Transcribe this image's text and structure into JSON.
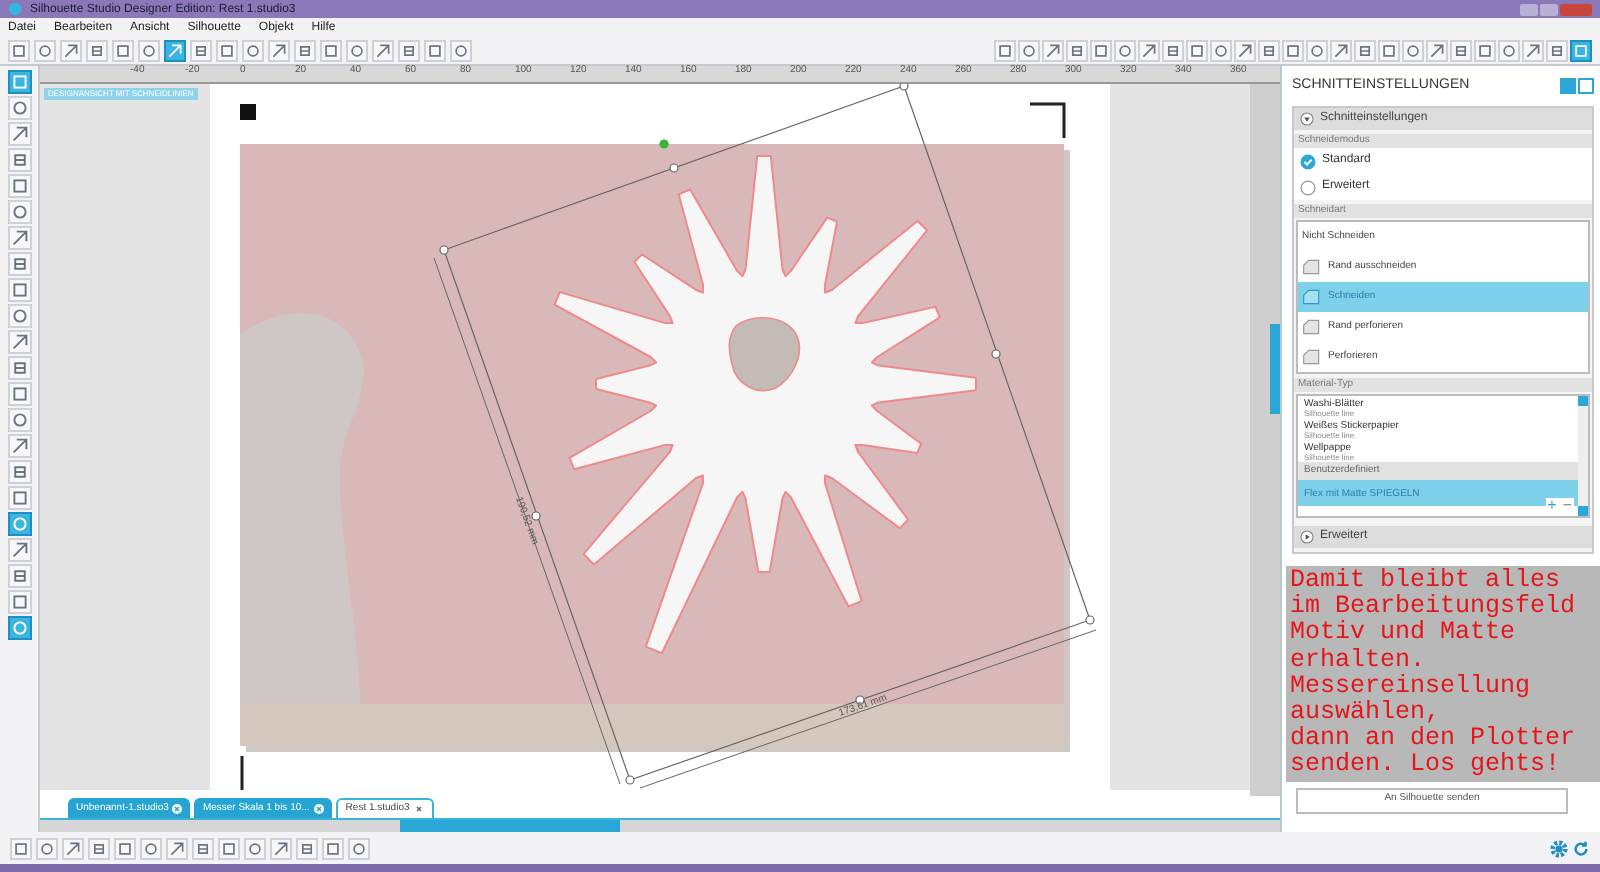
{
  "window": {
    "title": "Silhouette Studio Designer Edition: Rest 1.studio3"
  },
  "menu": [
    "Datei",
    "Bearbeiten",
    "Ansicht",
    "Silhouette",
    "Objekt",
    "Hilfe"
  ],
  "main_toolbar": [
    {
      "selected": false
    },
    {
      "selected": false
    },
    {
      "selected": false
    },
    {
      "selected": false
    },
    {
      "selected": false
    },
    {
      "selected": false
    },
    {
      "selected": true
    },
    {
      "selected": false
    },
    {
      "selected": false
    },
    {
      "selected": false
    },
    {
      "selected": false
    },
    {
      "selected": false
    },
    {
      "selected": false
    },
    {
      "selected": false
    },
    {
      "selected": false
    },
    {
      "selected": false
    },
    {
      "selected": false
    },
    {
      "selected": false
    }
  ],
  "right_toolbar": [
    {
      "selected": false
    },
    {
      "selected": false
    },
    {
      "selected": false
    },
    {
      "selected": false
    },
    {
      "selected": false
    },
    {
      "selected": false
    },
    {
      "selected": false
    },
    {
      "selected": false
    },
    {
      "selected": false
    },
    {
      "selected": false
    },
    {
      "selected": false
    },
    {
      "selected": false
    },
    {
      "selected": false
    },
    {
      "selected": false
    },
    {
      "selected": false
    },
    {
      "selected": false
    },
    {
      "selected": false
    },
    {
      "selected": false
    },
    {
      "selected": false
    },
    {
      "selected": false
    },
    {
      "selected": false
    },
    {
      "selected": false
    },
    {
      "selected": false
    },
    {
      "selected": false
    },
    {
      "selected": true
    }
  ],
  "left_tools": [
    {
      "selected": true
    },
    {
      "selected": false
    },
    {
      "selected": false
    },
    {
      "selected": false
    },
    {
      "selected": false
    },
    {
      "selected": false
    },
    {
      "selected": false
    },
    {
      "selected": false
    },
    {
      "selected": false
    },
    {
      "selected": false
    },
    {
      "selected": false
    },
    {
      "selected": false
    },
    {
      "selected": false
    },
    {
      "selected": false
    },
    {
      "selected": false
    },
    {
      "selected": false
    },
    {
      "selected": false
    },
    {
      "selected": true
    },
    {
      "selected": false
    },
    {
      "selected": false
    },
    {
      "selected": false
    },
    {
      "selected": true
    }
  ],
  "ruler": {
    "labels": [
      "-40",
      "-20",
      "0",
      "20",
      "40",
      "60",
      "80",
      "100",
      "120",
      "140",
      "160",
      "180",
      "200",
      "220",
      "240",
      "260",
      "280",
      "300",
      "320",
      "340",
      "360"
    ]
  },
  "canvas": {
    "view_label": "DESIGNANSICHT MIT SCHNEIDLINIEN",
    "height_label": "190,52 mm",
    "width_label": "173,61 mm"
  },
  "tabs": [
    {
      "label": "Unbenannt-1.studio3",
      "selected": false
    },
    {
      "label": "Messer Skala 1 bis 10...",
      "selected": false
    },
    {
      "label": "Rest 1.studio3",
      "selected": true
    }
  ],
  "bottom_toolbar": [
    {
      "selected": false
    },
    {
      "selected": false
    },
    {
      "selected": false
    },
    {
      "selected": false
    },
    {
      "selected": false
    },
    {
      "selected": false
    },
    {
      "selected": false
    },
    {
      "selected": false
    },
    {
      "selected": false
    },
    {
      "selected": false
    },
    {
      "selected": false
    },
    {
      "selected": false
    },
    {
      "selected": false
    },
    {
      "selected": false
    }
  ],
  "panel": {
    "title": "SCHNITTEINSTELLUNGEN",
    "section": {
      "label": "Schnitteinstellungen",
      "expanded": true
    },
    "mode_label": "Schneidemodus",
    "modes": [
      {
        "label": "Standard",
        "selected": true
      },
      {
        "label": "Erweitert",
        "selected": false
      }
    ],
    "cut_label": "Schneidart",
    "cut_types": [
      {
        "label": "Nicht Schneiden",
        "selected": false,
        "icon": false
      },
      {
        "label": "Rand ausschneiden",
        "selected": false,
        "icon": true
      },
      {
        "label": "Schneiden",
        "selected": true,
        "icon": true
      },
      {
        "label": "Rand perforieren",
        "selected": false,
        "icon": true
      },
      {
        "label": "Perforieren",
        "selected": false,
        "icon": true
      }
    ],
    "material_label": "Material-Typ",
    "materials": [
      {
        "kind": "item",
        "label": "Washi-Blätter",
        "sub": "Silhouette line",
        "selected": false
      },
      {
        "kind": "item",
        "label": "Weißes Stickerpapier",
        "sub": "Silhouette line",
        "selected": false
      },
      {
        "kind": "item",
        "label": "Wellpappe",
        "sub": "Silhouette line",
        "selected": false
      },
      {
        "kind": "group",
        "label": "Benutzerdefiniert"
      },
      {
        "kind": "item",
        "label": "Flex mit Matte SPIEGELN",
        "selected": true
      }
    ],
    "add": "+",
    "remove": "−",
    "advanced": {
      "label": "Erweitert",
      "expanded": false
    },
    "note": "Damit bleibt alles\nim Bearbeitungsfeld\nMotiv und Matte\nerhalten.\nMessereinsellung\nauswählen,\ndann an den Plotter\nsenden. Los gehts!",
    "send_button": "An Silhouette senden"
  }
}
